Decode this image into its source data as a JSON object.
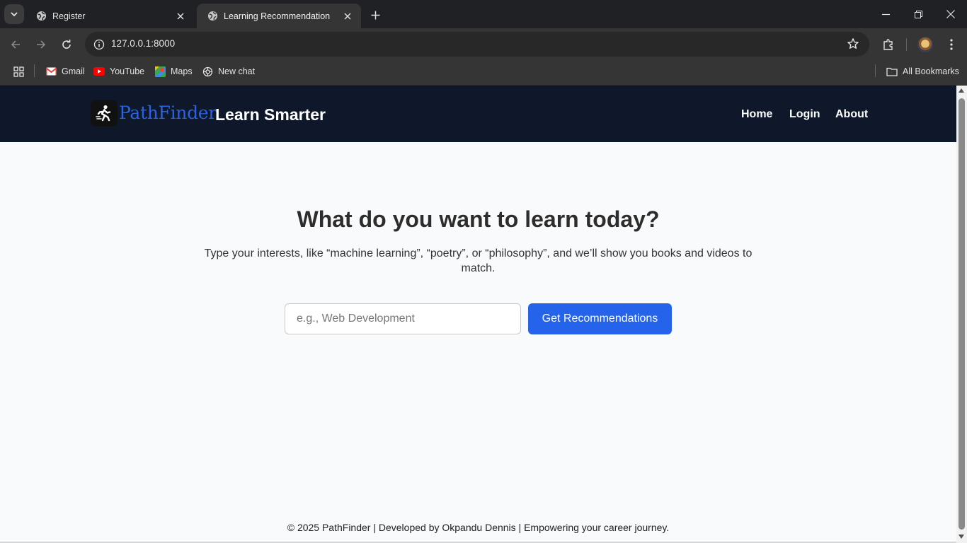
{
  "browser": {
    "tabs": [
      {
        "title": "Register",
        "active": false
      },
      {
        "title": "Learning Recommendation",
        "active": true
      }
    ],
    "url": "127.0.0.1:8000",
    "bookmarks": [
      "Gmail",
      "YouTube",
      "Maps",
      "New chat"
    ],
    "all_bookmarks": "All Bookmarks"
  },
  "header": {
    "logo_text": "PathFinder",
    "tagline": "Learn Smarter",
    "nav": [
      "Home",
      "Login",
      "About"
    ]
  },
  "hero": {
    "title": "What do you want to learn today?",
    "subtitle": "Type your interests, like “machine learning”, “poetry”, or “philosophy”, and we’ll show you books and videos to match."
  },
  "search": {
    "placeholder": "e.g., Web Development",
    "value": "",
    "button_label": "Get Recommendations"
  },
  "footer": {
    "text": "© 2025 PathFinder | Developed by Okpandu Dennis | Empowering your career journey."
  },
  "colors": {
    "header_bg": "#0f172a",
    "accent": "#2563eb",
    "page_bg": "#f8fafc"
  }
}
